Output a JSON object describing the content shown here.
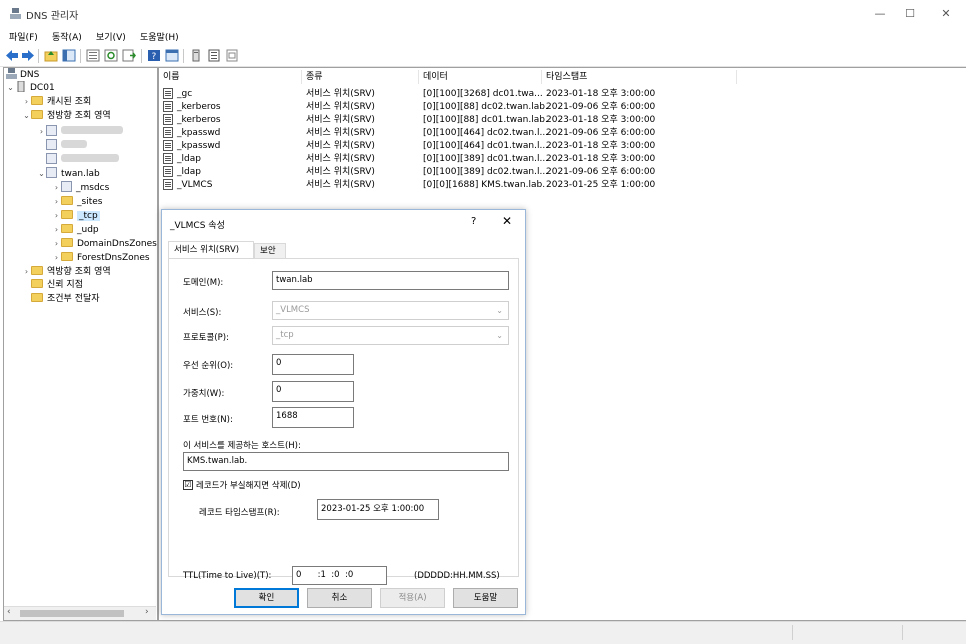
{
  "window": {
    "title": "DNS 관리자",
    "controls": {
      "minimize": "—",
      "maximize": "☐",
      "close": "✕"
    }
  },
  "menu": [
    "파일(F)",
    "동작(A)",
    "보기(V)",
    "도움말(H)"
  ],
  "tree": {
    "root": "DNS",
    "server": "DC01",
    "cached": "캐시된 조회",
    "forward": "정방향 조회 영역",
    "zone": "twan.lab",
    "msdcs": "_msdcs",
    "sites": "_sites",
    "tcp": "_tcp",
    "udp": "_udp",
    "domaindns": "DomainDnsZones",
    "forestdns": "ForestDnsZones",
    "reverse": "역방향 조회 영역",
    "trust": "신뢰 지점",
    "conditional": "조건부 전달자"
  },
  "list": {
    "headers": [
      "이름",
      "종류",
      "데이터",
      "타임스탬프"
    ],
    "rows": [
      {
        "name": "_gc",
        "type": "서비스 위치(SRV)",
        "data": "[0][100][3268] dc01.twa...",
        "ts": "2023-01-18 오후 3:00:00"
      },
      {
        "name": "_kerberos",
        "type": "서비스 위치(SRV)",
        "data": "[0][100][88] dc02.twan.lab.",
        "ts": "2021-09-06 오후 6:00:00"
      },
      {
        "name": "_kerberos",
        "type": "서비스 위치(SRV)",
        "data": "[0][100][88] dc01.twan.lab.",
        "ts": "2023-01-18 오후 3:00:00"
      },
      {
        "name": "_kpasswd",
        "type": "서비스 위치(SRV)",
        "data": "[0][100][464] dc02.twan.l...",
        "ts": "2021-09-06 오후 6:00:00"
      },
      {
        "name": "_kpasswd",
        "type": "서비스 위치(SRV)",
        "data": "[0][100][464] dc01.twan.l...",
        "ts": "2023-01-18 오후 3:00:00"
      },
      {
        "name": "_ldap",
        "type": "서비스 위치(SRV)",
        "data": "[0][100][389] dc01.twan.l...",
        "ts": "2023-01-18 오후 3:00:00"
      },
      {
        "name": "_ldap",
        "type": "서비스 위치(SRV)",
        "data": "[0][100][389] dc02.twan.l...",
        "ts": "2021-09-06 오후 6:00:00"
      },
      {
        "name": "_VLMCS",
        "type": "서비스 위치(SRV)",
        "data": "[0][0][1688] KMS.twan.lab.",
        "ts": "2023-01-25 오후 1:00:00"
      }
    ]
  },
  "dialog": {
    "title": "_VLMCS 속성",
    "help": "?",
    "close": "✕",
    "tabs": [
      "서비스 위치(SRV)",
      "보안"
    ],
    "domain_label": "도메인(M):",
    "domain_value": "twan.lab",
    "service_label": "서비스(S):",
    "service_value": "_VLMCS",
    "protocol_label": "프로토콜(P):",
    "protocol_value": "_tcp",
    "priority_label": "우선 순위(O):",
    "priority_value": "0",
    "weight_label": "가중치(W):",
    "weight_value": "0",
    "port_label": "포트 번호(N):",
    "port_value": "1688",
    "host_label": "이 서비스를 제공하는 호스트(H):",
    "host_value": "KMS.twan.lab.",
    "delete_stale_label": "레코드가 부실해지면 삭제(D)",
    "delete_stale_checked": "☑",
    "timestamp_label": "레코드 타임스탬프(R):",
    "timestamp_value": "2023-01-25 오후 1:00:00",
    "ttl_label": "TTL(Time to Live)(T):",
    "ttl_value": "0      :1  :0  :0",
    "ttl_format": "(DDDDD:HH.MM.SS)",
    "buttons": {
      "ok": "확인",
      "cancel": "취소",
      "apply": "적용(A)",
      "help": "도움말"
    }
  },
  "accent": "#0078d7"
}
